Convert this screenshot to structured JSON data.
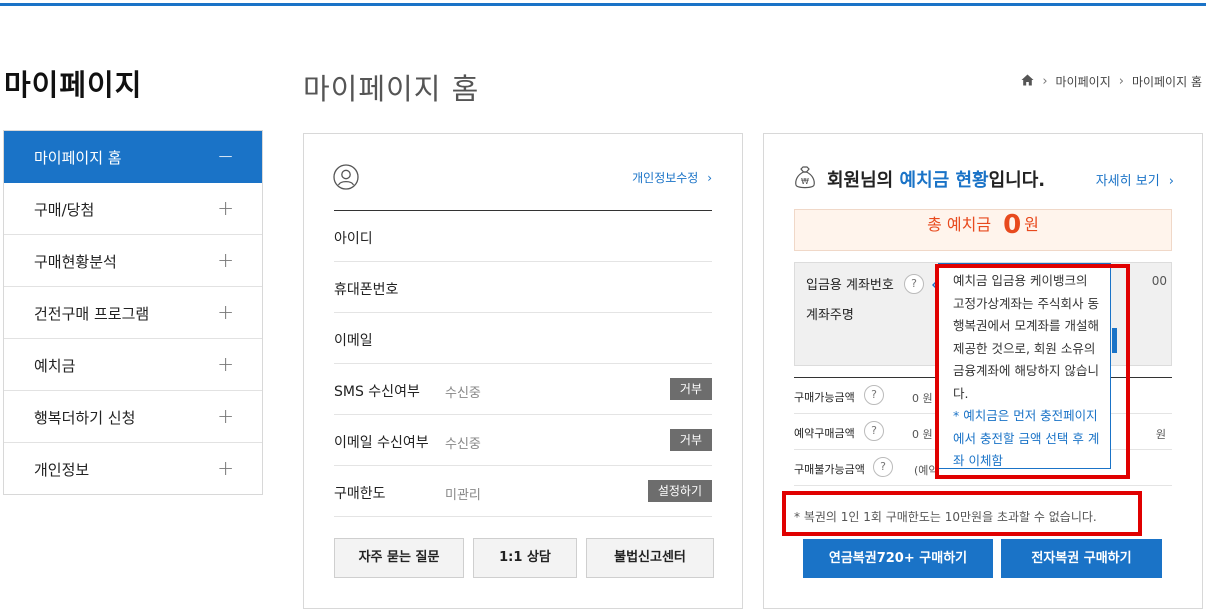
{
  "sidebar": {
    "title": "마이페이지",
    "items": [
      {
        "label": "마이페이지 홈",
        "toggle": "−"
      },
      {
        "label": "구매/당첨",
        "toggle": "+"
      },
      {
        "label": "구매현황분석",
        "toggle": "+"
      },
      {
        "label": "건전구매 프로그램",
        "toggle": "+"
      },
      {
        "label": "예치금",
        "toggle": "+"
      },
      {
        "label": "행복더하기 신청",
        "toggle": "+"
      },
      {
        "label": "개인정보",
        "toggle": "+"
      }
    ]
  },
  "header": {
    "title": "마이페이지 홈",
    "breadcrumb": [
      "마이페이지",
      "마이페이지 홈"
    ]
  },
  "profile": {
    "edit_link": "개인정보수정",
    "rows": [
      {
        "label": "아이디",
        "value": "",
        "button": ""
      },
      {
        "label": "휴대폰번호",
        "value": "",
        "button": ""
      },
      {
        "label": "이메일",
        "value": "",
        "button": ""
      },
      {
        "label": "SMS 수신여부",
        "value": "수신중",
        "button": "거부"
      },
      {
        "label": "이메일 수신여부",
        "value": "수신중",
        "button": "거부"
      },
      {
        "label": "구매한도",
        "value": "미관리",
        "button": "설정하기"
      }
    ],
    "buttons": [
      "자주 묻는 질문",
      "1:1 상담",
      "불법신고센터"
    ]
  },
  "deposit": {
    "title_prefix": "회원님의 ",
    "title_highlight": "예치금 현황",
    "title_suffix": "입니다.",
    "more_link": "자세히 보기",
    "total_label": "총 예치금",
    "total_amount": "0",
    "total_unit": "원",
    "account_label": "입금용 계좌번호",
    "account_holder_label": "계좌주명",
    "account_peek": "00",
    "amounts": [
      {
        "label": "구매가능금액",
        "value": "0 원",
        "right": ""
      },
      {
        "label": "예약구매금액",
        "value": "0 원",
        "right": "원"
      },
      {
        "label": "구매불가능금액",
        "value": "(예약",
        "right": ""
      }
    ],
    "notice": "* 복권의 1인 1회 구매한도는 10만원을 초과할 수 없습니다.",
    "buy_buttons": [
      "연금복권720+ 구매하기",
      "전자복권 구매하기"
    ]
  },
  "tooltip": {
    "text": "예치금 입금용 케이뱅크의 고정가상계좌는 주식회사 동행복권에서 모계좌를 개설해 제공한 것으로, 회원 소유의 금융계좌에 해당하지 않습니다.",
    "note": "* 예치금은 먼저 충전페이지에서 충전할 금액 선택 후 계좌 이체함"
  },
  "help_symbol": "?",
  "colors": {
    "accent": "#1a73c7",
    "highlight_box": "#e00000",
    "total_amount": "#e84a1e"
  }
}
